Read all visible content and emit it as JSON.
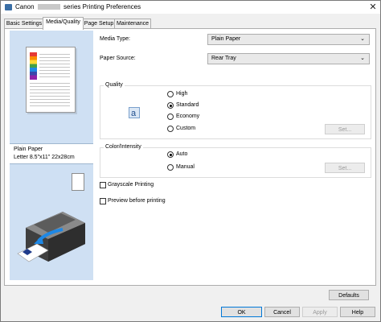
{
  "window": {
    "title_prefix": "Canon",
    "title_suffix": "series Printing Preferences",
    "close_glyph": "✕"
  },
  "tabs": [
    {
      "label": "Basic Settings",
      "active": false
    },
    {
      "label": "Media/Quality",
      "active": true
    },
    {
      "label": "Page Setup",
      "active": false
    },
    {
      "label": "Maintenance",
      "active": false
    }
  ],
  "preview": {
    "paper_name": "Plain Paper",
    "paper_size": "Letter 8.5\"x11\" 22x28cm"
  },
  "media_type": {
    "label": "Media Type:",
    "value": "Plain Paper"
  },
  "paper_source": {
    "label": "Paper Source:",
    "value": "Rear Tray"
  },
  "quality": {
    "group_label": "Quality",
    "options": [
      "High",
      "Standard",
      "Economy",
      "Custom"
    ],
    "selected": "Standard",
    "set_button": "Set..."
  },
  "color_intensity": {
    "group_label": "Color/Intensity",
    "options": [
      "Auto",
      "Manual"
    ],
    "selected": "Auto",
    "set_button": "Set..."
  },
  "checkboxes": {
    "grayscale": {
      "label": "Grayscale Printing",
      "checked": false
    },
    "preview": {
      "label": "Preview before printing",
      "checked": false
    }
  },
  "buttons": {
    "defaults": "Defaults",
    "ok": "OK",
    "cancel": "Cancel",
    "apply": "Apply",
    "help": "Help"
  },
  "colors": {
    "preview_bg": "#cfe0f3",
    "accent": "#0078d7",
    "printer_arrow": "#1e88e5"
  },
  "icons": {
    "app": "printer-app-icon",
    "quality": "quality-a-icon",
    "printer": "printer-illustration-icon"
  }
}
